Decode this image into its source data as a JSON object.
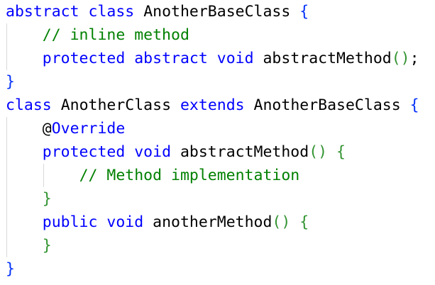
{
  "editor": {
    "colors": {
      "keyword": "#0000ff",
      "identifier": "#000000",
      "comment": "#008000",
      "bracket_outer": "#0431fa",
      "bracket_inner": "#319331",
      "annotation_symbol": "#000000",
      "guide": "#d9d9d9"
    },
    "lines": [
      {
        "indent": 0,
        "tokens": [
          {
            "text": "abstract",
            "kind": "keyword"
          },
          {
            "text": " ",
            "kind": "space"
          },
          {
            "text": "class",
            "kind": "keyword"
          },
          {
            "text": " ",
            "kind": "space"
          },
          {
            "text": "AnotherBaseClass",
            "kind": "identifier"
          },
          {
            "text": " ",
            "kind": "space"
          },
          {
            "text": "{",
            "kind": "bracket_outer"
          }
        ]
      },
      {
        "indent": 1,
        "tokens": [
          {
            "text": "// inline method",
            "kind": "comment"
          }
        ]
      },
      {
        "indent": 1,
        "tokens": [
          {
            "text": "protected",
            "kind": "keyword"
          },
          {
            "text": " ",
            "kind": "space"
          },
          {
            "text": "abstract",
            "kind": "keyword"
          },
          {
            "text": " ",
            "kind": "space"
          },
          {
            "text": "void",
            "kind": "keyword"
          },
          {
            "text": " ",
            "kind": "space"
          },
          {
            "text": "abstractMethod",
            "kind": "identifier"
          },
          {
            "text": "()",
            "kind": "bracket_inner"
          },
          {
            "text": ";",
            "kind": "identifier"
          }
        ]
      },
      {
        "indent": 0,
        "tokens": [
          {
            "text": "}",
            "kind": "bracket_outer"
          }
        ]
      },
      {
        "indent": 0,
        "tokens": [
          {
            "text": "class",
            "kind": "keyword"
          },
          {
            "text": " ",
            "kind": "space"
          },
          {
            "text": "AnotherClass",
            "kind": "identifier"
          },
          {
            "text": " ",
            "kind": "space"
          },
          {
            "text": "extends",
            "kind": "keyword"
          },
          {
            "text": " ",
            "kind": "space"
          },
          {
            "text": "AnotherBaseClass",
            "kind": "identifier"
          },
          {
            "text": " ",
            "kind": "space"
          },
          {
            "text": "{",
            "kind": "bracket_outer"
          }
        ]
      },
      {
        "indent": 1,
        "tokens": [
          {
            "text": "@",
            "kind": "annotation_symbol"
          },
          {
            "text": "Override",
            "kind": "keyword"
          }
        ]
      },
      {
        "indent": 1,
        "tokens": [
          {
            "text": "protected",
            "kind": "keyword"
          },
          {
            "text": " ",
            "kind": "space"
          },
          {
            "text": "void",
            "kind": "keyword"
          },
          {
            "text": " ",
            "kind": "space"
          },
          {
            "text": "abstractMethod",
            "kind": "identifier"
          },
          {
            "text": "()",
            "kind": "bracket_inner"
          },
          {
            "text": " ",
            "kind": "space"
          },
          {
            "text": "{",
            "kind": "bracket_inner"
          }
        ]
      },
      {
        "indent": 2,
        "tokens": [
          {
            "text": "// Method implementation",
            "kind": "comment"
          }
        ]
      },
      {
        "indent": 1,
        "tokens": [
          {
            "text": "}",
            "kind": "bracket_inner"
          }
        ]
      },
      {
        "indent": 1,
        "tokens": [
          {
            "text": "public",
            "kind": "keyword"
          },
          {
            "text": " ",
            "kind": "space"
          },
          {
            "text": "void",
            "kind": "keyword"
          },
          {
            "text": " ",
            "kind": "space"
          },
          {
            "text": "anotherMethod",
            "kind": "identifier"
          },
          {
            "text": "()",
            "kind": "bracket_inner"
          },
          {
            "text": " ",
            "kind": "space"
          },
          {
            "text": "{",
            "kind": "bracket_inner"
          }
        ]
      },
      {
        "indent": 1,
        "tokens": [
          {
            "text": "}",
            "kind": "bracket_inner"
          }
        ]
      },
      {
        "indent": 0,
        "tokens": [
          {
            "text": "}",
            "kind": "bracket_outer"
          }
        ]
      }
    ]
  }
}
